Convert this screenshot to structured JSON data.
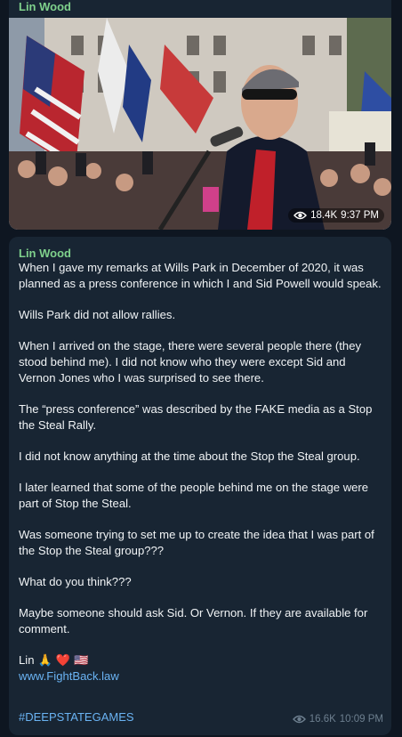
{
  "post1": {
    "author": "Lin Wood",
    "views": "18.4K",
    "time": "9:37 PM",
    "image_icon": "photo-of-speaker-at-rally"
  },
  "post2": {
    "author": "Lin Wood",
    "paragraphs": [
      "When I gave my remarks at Wills Park in December of 2020, it was planned as a press conference in which I and Sid Powell would speak.",
      "Wills Park did not allow rallies.",
      "When I arrived on the stage, there were several people there (they stood behind me). I did not know who they were except Sid and Vernon Jones who I was surprised to see there.",
      "The “press conference” was described by the FAKE media as a Stop the Steal Rally.",
      "I did not know anything at the time about the Stop the Steal group.",
      "I later learned that some of the people behind me on the stage were part of Stop the Steal.",
      "Was someone trying to set me up to create the idea that I was part of the Stop the Steal group???",
      "What do you think???",
      "Maybe someone should ask Sid. Or Vernon. If they are available for comment."
    ],
    "signature": "Lin",
    "signature_emojis": [
      "🙏",
      "❤️",
      "🇺🇸"
    ],
    "link": "www.FightBack.law",
    "hashtag": "#DEEPSTATEGAMES",
    "views": "16.6K",
    "time": "10:09 PM"
  },
  "colors": {
    "background": "#0e1621",
    "bubble": "#182533",
    "author": "#7fd18c",
    "link": "#6ab3f3",
    "meta": "#6d7f8f"
  },
  "icons": [
    "eye-icon"
  ]
}
